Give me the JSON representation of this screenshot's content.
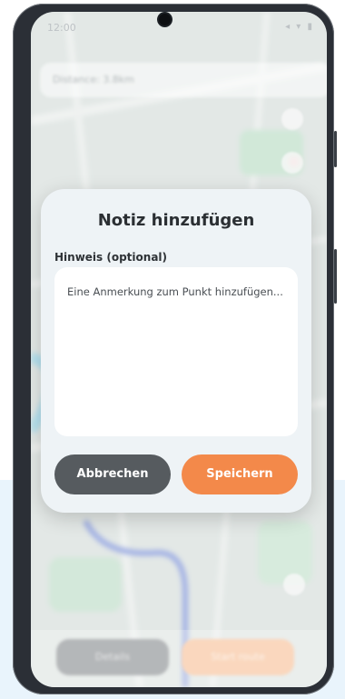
{
  "status_bar": {
    "time": "12:00",
    "icons": "◂ ▾ ▮"
  },
  "map": {
    "search_placeholder": "Distance: 3.8km"
  },
  "bottom_bar": {
    "left_label": "Details",
    "right_label": "Start route"
  },
  "dialog": {
    "title": "Notiz hinzufügen",
    "field_label": "Hinweis (optional)",
    "field_placeholder": "Eine Anmerkung zum Punkt hinzufügen...",
    "field_value": "",
    "cancel_label": "Abbrechen",
    "save_label": "Speichern"
  },
  "colors": {
    "cancel_button": "#565b5f",
    "save_button": "#f3894a",
    "dialog_background": "#eef3f6",
    "route_line": "#6f86d6"
  }
}
